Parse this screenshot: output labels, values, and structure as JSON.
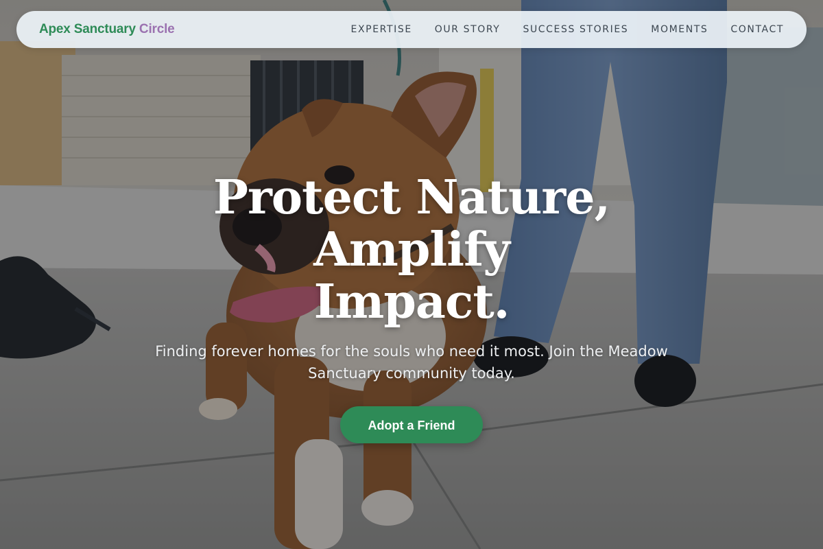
{
  "page": {
    "brand_main": "Apex Sanctuary",
    "brand_accent": "Circle"
  },
  "nav": {
    "items": [
      {
        "label": "EXPERTISE"
      },
      {
        "label": "OUR STORY"
      },
      {
        "label": "SUCCESS STORIES"
      },
      {
        "label": "MOMENTS"
      },
      {
        "label": "CONTACT"
      }
    ]
  },
  "hero": {
    "title_line1": "Protect Nature, Amplify",
    "title_line2": "Impact.",
    "subtitle": "Finding forever homes for the souls who need it most. Join the Meadow Sanctuary community today.",
    "cta_label": "Adopt a Friend",
    "background_image": "dog-on-leash-photo"
  },
  "colors": {
    "brand_green": "#2e8b57",
    "brand_purple": "#9b72b0",
    "nav_text": "#3c4650",
    "nav_background": "#ecf2f7"
  }
}
